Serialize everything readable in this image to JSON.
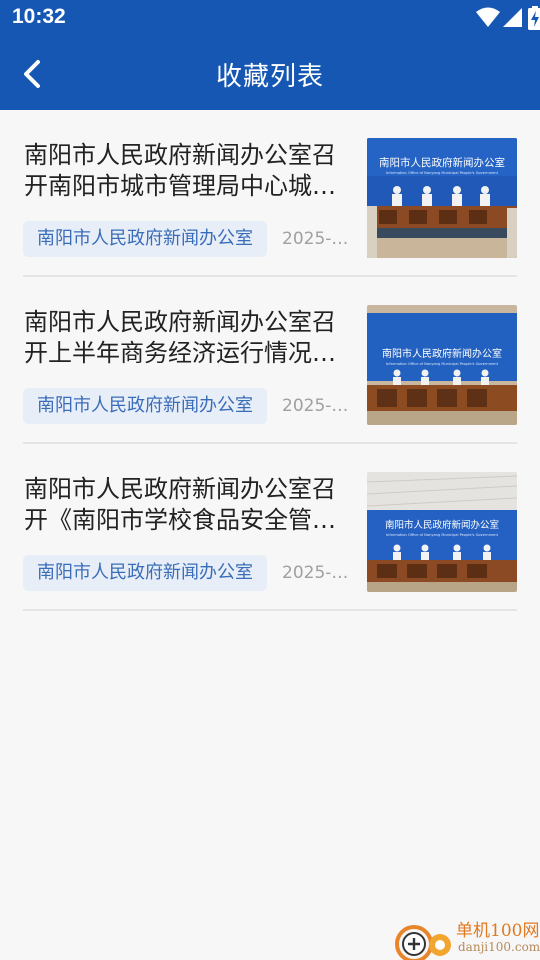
{
  "status_bar": {
    "time": "10:32",
    "icons": [
      "wifi-icon",
      "signal-icon",
      "battery-charging-icon"
    ]
  },
  "nav": {
    "back_icon": "chevron-left-icon",
    "title": "收藏列表"
  },
  "theme": {
    "primary": "#1557b3",
    "tag_bg": "#e8eef8",
    "tag_text": "#3a6db8",
    "background": "#f7f7f8"
  },
  "favorites": [
    {
      "title": "南阳市人民政府新闻办公室召开南阳市城市管理局中心城…",
      "source": "南阳市人民政府新闻办公室",
      "date": "2025-0…",
      "thumbnail": {
        "banner_text": "南阳市人民政府新闻办公室",
        "banner_subtext": "Information Office of Nanyang Municipal People's Government"
      }
    },
    {
      "title": "南阳市人民政府新闻办公室召开上半年商务经济运行情况…",
      "source": "南阳市人民政府新闻办公室",
      "date": "2025-0…",
      "thumbnail": {
        "banner_text": "南阳市人民政府新闻办公室",
        "banner_subtext": "Information Office of Nanyang Municipal People's Government"
      }
    },
    {
      "title": "南阳市人民政府新闻办公室召开《南阳市学校食品安全管…",
      "source": "南阳市人民政府新闻办公室",
      "date": "2025-0…",
      "thumbnail": {
        "banner_text": "南阳市人民政府新闻办公室",
        "banner_subtext": "Information Office of Nanyang Municipal People's Government"
      }
    }
  ],
  "watermark": {
    "name": "单机100网",
    "url": "danji100.com"
  }
}
